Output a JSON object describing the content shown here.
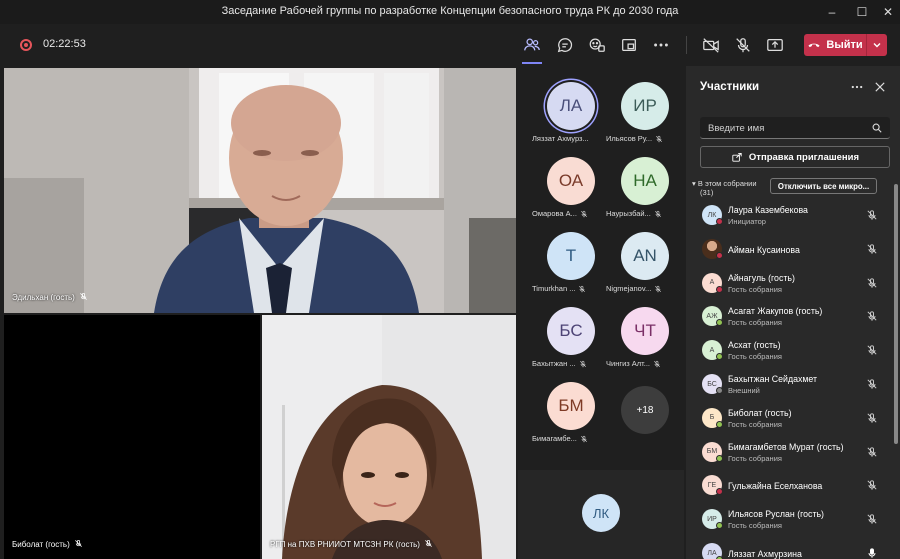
{
  "window": {
    "title": "Заседание Рабочей группы по разработке Концепции безопасного труда РК до 2030 года"
  },
  "toolbar": {
    "timer": "02:22:53",
    "leave_label": "Выйти"
  },
  "main_tiles": {
    "speaker_label": "Эдильхан (гость)",
    "bottom_left_label": "Биболат (гость)",
    "bottom_right_label": "РГП на ПХВ РНИИОТ МТСЗН РК (гость)"
  },
  "gallery": {
    "items": [
      {
        "initials": "ЛА",
        "name": "Ляззат Ахмурз...",
        "bg": "#d6daf2",
        "fg": "#4a4f7a",
        "muted": false,
        "active": true
      },
      {
        "initials": "ИР",
        "name": "Ильясов Ру...",
        "bg": "#d6ece9",
        "fg": "#3c5c58",
        "muted": true,
        "active": false
      },
      {
        "initials": "ОА",
        "name": "Омарова А...",
        "bg": "#f9dcd3",
        "fg": "#7a3b2a",
        "muted": true,
        "active": false
      },
      {
        "initials": "НА",
        "name": "Наурызбай...",
        "bg": "#d8f0d4",
        "fg": "#2f6a2a",
        "muted": true,
        "active": false
      },
      {
        "initials": "T",
        "name": "Timurkhan ...",
        "bg": "#cfe4f7",
        "fg": "#305b82",
        "muted": true,
        "active": false
      },
      {
        "initials": "AN",
        "name": "Nigmejanov...",
        "bg": "#dceaf2",
        "fg": "#355468",
        "muted": true,
        "active": false
      },
      {
        "initials": "БС",
        "name": "Бахытжан ...",
        "bg": "#e4e1f4",
        "fg": "#4d4475",
        "muted": true,
        "active": false
      },
      {
        "initials": "ЧТ",
        "name": "Чингиз Алт...",
        "bg": "#f7d9ef",
        "fg": "#7a2f66",
        "muted": true,
        "active": false
      },
      {
        "initials": "БМ",
        "name": "Бимагамбе...",
        "bg": "#fbdcd2",
        "fg": "#7e3a25",
        "muted": true,
        "active": false
      },
      {
        "initials": "+18",
        "name": "",
        "bg": "#3d3d3d",
        "fg": "#ffffff",
        "muted": false,
        "active": false
      }
    ],
    "bottom_tile_initials": "ЛК"
  },
  "panel": {
    "title": "Участники",
    "search_placeholder": "Введите имя",
    "invite_label": "Отправка приглашения",
    "section_line1": "В этом собрании",
    "section_line2": "(31)",
    "mute_all_label": "Отключить все микро...",
    "participants": [
      {
        "initials": "ЛК",
        "name": "Лаура Казембекова",
        "role": "Инициатор",
        "bg": "#cfe4f7",
        "status": "#c4314b"
      },
      {
        "initials": "",
        "name": "Айман Кусаинова",
        "role": "",
        "bg": "#6a4a2e",
        "status": "#c4314b",
        "photo": true
      },
      {
        "initials": "А",
        "name": "Айнагуль (гость)",
        "role": "Гость собрания",
        "bg": "#fbdcd2",
        "status": "#c4314b"
      },
      {
        "initials": "АЖ",
        "name": "Асагат Жакупов (гость)",
        "role": "Гость собрания",
        "bg": "#d8f0d4",
        "status": "#92c353"
      },
      {
        "initials": "А",
        "name": "Асхат (гость)",
        "role": "Гость собрания",
        "bg": "#d8f0d4",
        "status": "#92c353"
      },
      {
        "initials": "БС",
        "name": "Бахытжан Сейдахмет",
        "role": "Внешний",
        "bg": "#e4e1f4",
        "status": "#888888"
      },
      {
        "initials": "Б",
        "name": "Биболат (гость)",
        "role": "Гость собрания",
        "bg": "#fde7c8",
        "status": "#92c353"
      },
      {
        "initials": "БМ",
        "name": "Бимагамбетов Мурат (гость)",
        "role": "Гость собрания",
        "bg": "#fbdcd2",
        "status": "#92c353"
      },
      {
        "initials": "ГЕ",
        "name": "Гульжайна Еселханова",
        "role": "",
        "bg": "#f9dcd3",
        "status": "#c4314b"
      },
      {
        "initials": "ИР",
        "name": "Ильясов Руслан (гость)",
        "role": "Гость собрания",
        "bg": "#d6ece9",
        "status": "#92c353"
      },
      {
        "initials": "ЛА",
        "name": "Ляззат Ахмурзина",
        "role": "",
        "bg": "#d6daf2",
        "status": "#92c353",
        "mic_on": true
      }
    ]
  }
}
